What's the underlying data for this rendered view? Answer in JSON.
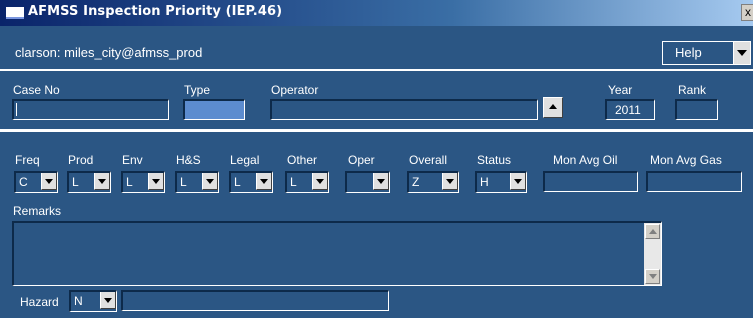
{
  "window": {
    "title": "AFMSS Inspection Priority (IEP.46)",
    "close_glyph": "x"
  },
  "header": {
    "user_text": "clarson: miles_city@afmss_prod",
    "help_label": "Help"
  },
  "case": {
    "case_no_label": "Case No",
    "case_no_value": "",
    "type_label": "Type",
    "type_value": "",
    "operator_label": "Operator",
    "operator_value": "",
    "year_label": "Year",
    "year_value": "2011",
    "rank_label": "Rank",
    "rank_value": ""
  },
  "ratings": {
    "freq": {
      "label": "Freq",
      "value": "C"
    },
    "prod": {
      "label": "Prod",
      "value": "L"
    },
    "env": {
      "label": "Env",
      "value": "L"
    },
    "hs": {
      "label": "H&S",
      "value": "L"
    },
    "legal": {
      "label": "Legal",
      "value": "L"
    },
    "other": {
      "label": "Other",
      "value": "L"
    },
    "oper": {
      "label": "Oper",
      "value": ""
    },
    "overall": {
      "label": "Overall",
      "value": "Z"
    },
    "status": {
      "label": "Status",
      "value": "H"
    },
    "mon_avg_oil": {
      "label": "Mon Avg Oil",
      "value": ""
    },
    "mon_avg_gas": {
      "label": "Mon Avg Gas",
      "value": ""
    }
  },
  "remarks": {
    "label": "Remarks",
    "value": ""
  },
  "hazard": {
    "label": "Hazard",
    "value": "N",
    "text_value": ""
  },
  "colors": {
    "panel": "#2b5684",
    "field_light": "#5c8ccf",
    "title_start": "#0a246a"
  },
  "icons": [
    "window-icon",
    "close-icon",
    "dropdown-arrow-icon",
    "up-arrow-icon",
    "scroll-up-icon",
    "scroll-down-icon"
  ]
}
